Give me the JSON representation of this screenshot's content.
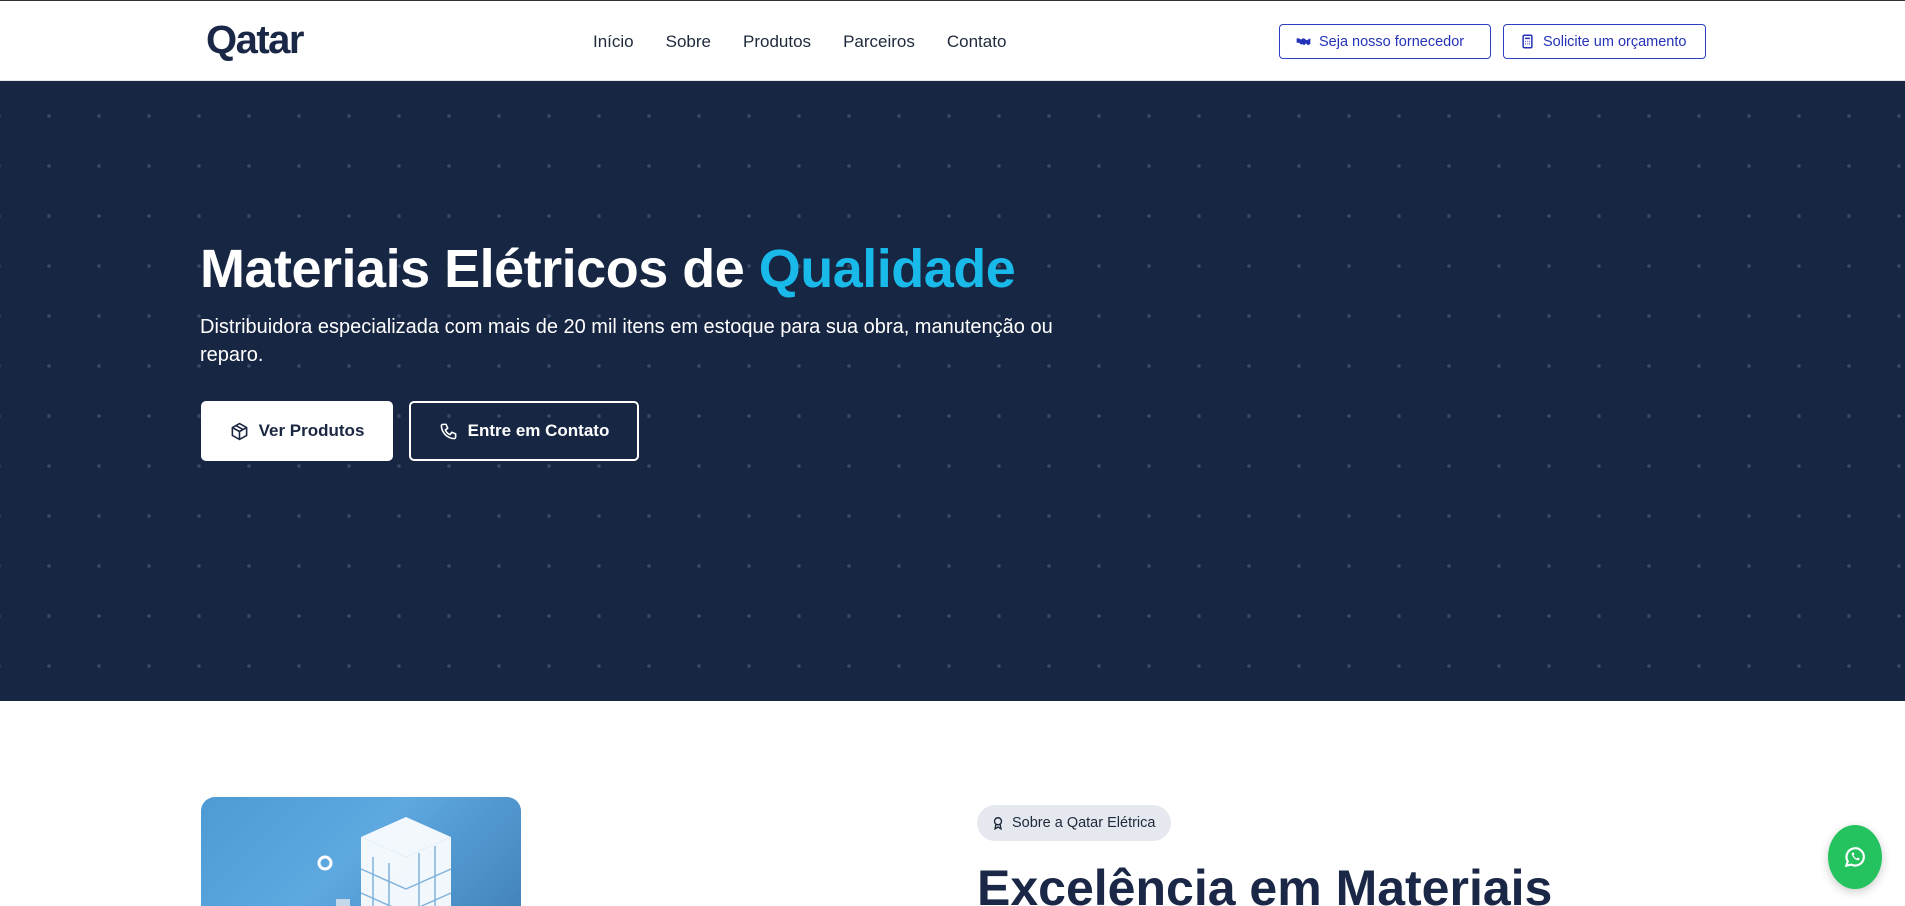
{
  "header": {
    "logo": "Qatar",
    "nav": [
      {
        "label": "Início"
      },
      {
        "label": "Sobre"
      },
      {
        "label": "Produtos"
      },
      {
        "label": "Parceiros"
      },
      {
        "label": "Contato"
      }
    ],
    "supplier_button": "Seja nosso fornecedor",
    "quote_button": "Solicite um orçamento"
  },
  "hero": {
    "title_main": "Materiais Elétricos de",
    "title_accent": "Qualidade",
    "subtitle": "Distribuidora especializada com mais de 20 mil itens em estoque para sua obra, manutenção ou reparo.",
    "primary_button": "Ver Produtos",
    "secondary_button": "Entre em Contato"
  },
  "about": {
    "badge": "Sobre a Qatar Elétrica",
    "title": "Excelência em Materiais"
  },
  "colors": {
    "hero_bg": "#172642",
    "accent": "#19b9ea",
    "header_button": "#2332b8",
    "whatsapp": "#25c35f"
  },
  "icons": {
    "supplier": "handshake-icon",
    "quote": "calculator-icon",
    "products": "package-icon",
    "contact": "phone-icon",
    "badge": "award-icon",
    "floating": "whatsapp-icon"
  }
}
